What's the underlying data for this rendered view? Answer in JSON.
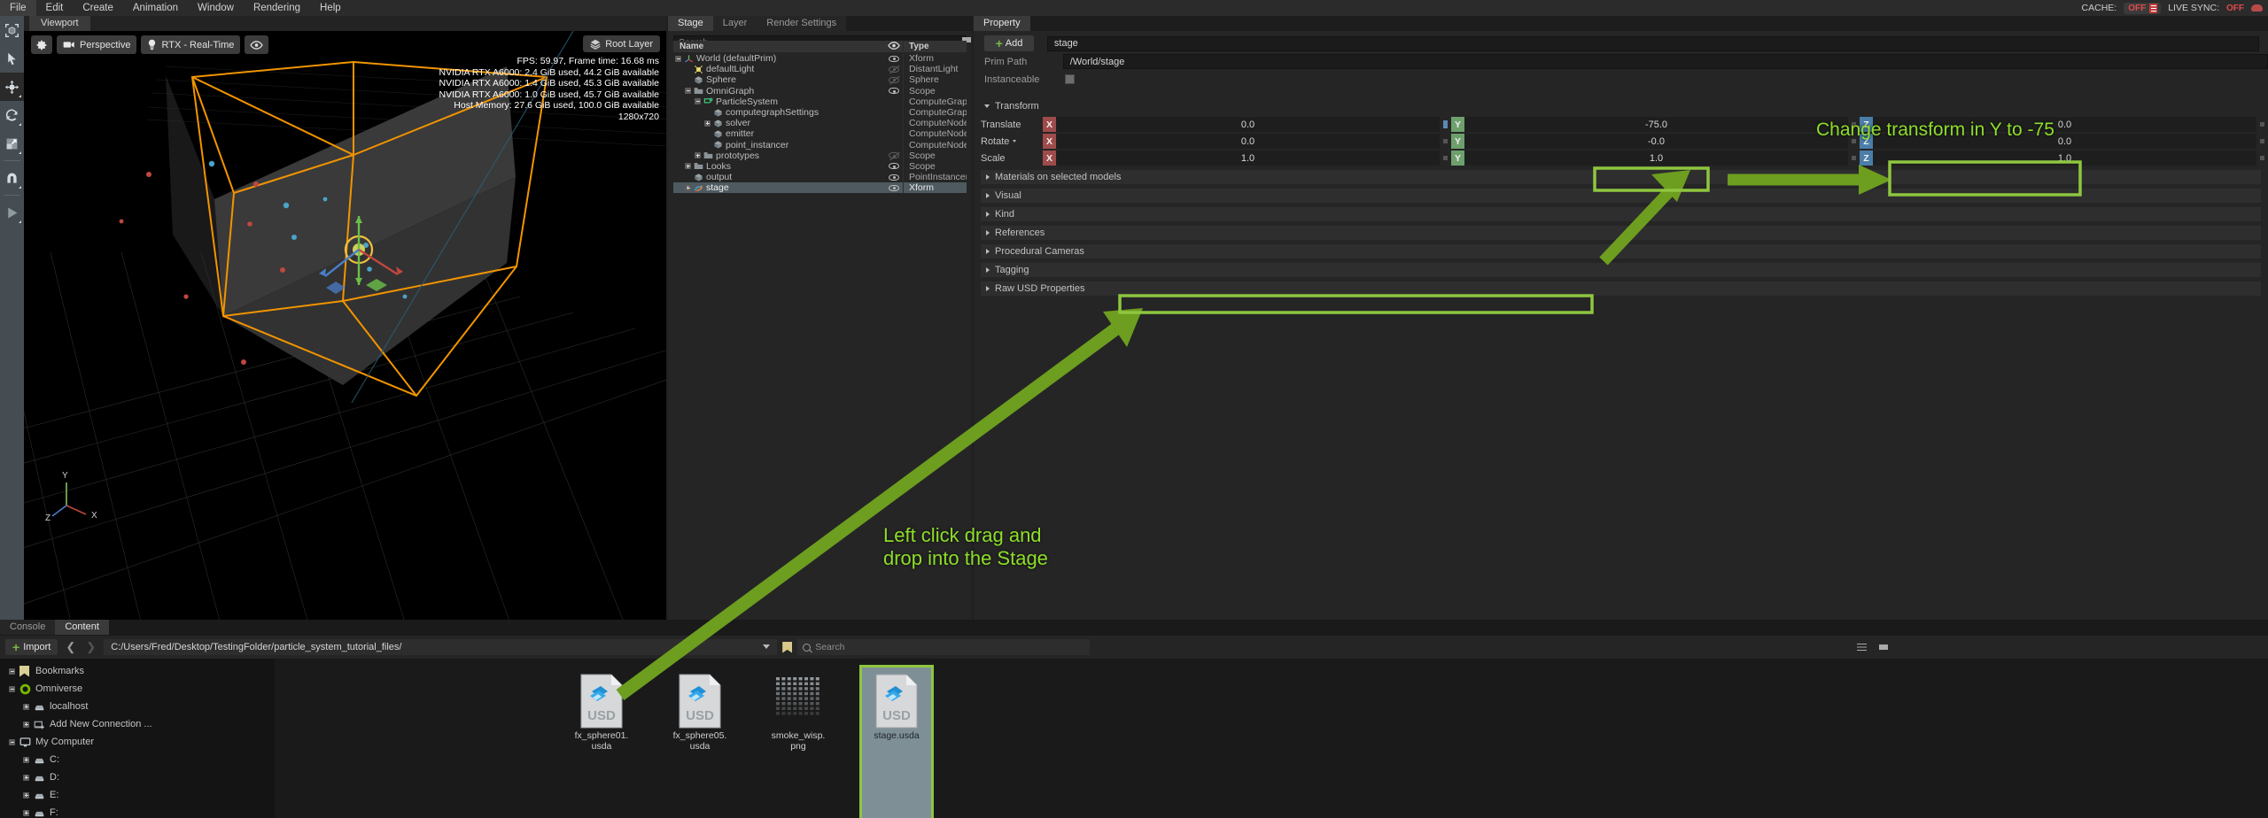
{
  "app": {
    "menu": [
      "File",
      "Edit",
      "Create",
      "Animation",
      "Window",
      "Rendering",
      "Help"
    ],
    "cache": {
      "label": "CACHE:",
      "value": "OFF",
      "icon": "document-icon"
    },
    "live_sync": {
      "label": "LIVE SYNC:",
      "value": "OFF",
      "icon": "cloud-icon"
    }
  },
  "left_toolbar": {
    "items": [
      {
        "name": "select-object-tool",
        "icon": "cube-in-brackets-icon",
        "selected": false
      },
      {
        "name": "pointer-tool",
        "icon": "cursor-arrow-icon",
        "selected": false
      },
      {
        "name": "move-tool",
        "icon": "move-arrows-icon",
        "selected": true
      },
      {
        "name": "rotate-tool",
        "icon": "rotate-circle-icon",
        "selected": false
      },
      {
        "name": "scale-tool",
        "icon": "scale-square-icon",
        "selected": false
      },
      {
        "name": "snap-tool",
        "icon": "magnet-icon",
        "selected": false
      },
      {
        "name": "play-tool",
        "icon": "play-triangle-icon",
        "selected": false
      }
    ]
  },
  "viewport": {
    "tab": "Viewport",
    "toolbar": {
      "settings_icon": "gear-icon",
      "camera_label": "Perspective",
      "camera_icon": "movie-camera-icon",
      "renderer_label": "RTX - Real-Time",
      "renderer_icon": "lightbulb-icon",
      "visibility_icon": "eye-icon"
    },
    "root_layer": {
      "label": "Root Layer",
      "icon": "layers-icon"
    },
    "stats": [
      "FPS: 59.97, Frame time: 16.68 ms",
      "NVIDIA RTX A6000: 2.4 GiB used,  44.2 GiB available",
      "NVIDIA RTX A6000: 1.4 GiB used,  45.3 GiB available",
      "NVIDIA RTX A6000: 1.0 GiB used,  45.7 GiB available",
      "Host Memory: 27.6 GiB used, 100.0 GiB available",
      "1280x720"
    ],
    "axis_gizmo": {
      "y": "Y",
      "x": "X",
      "z": "Z"
    }
  },
  "stage": {
    "tabs": [
      {
        "label": "Stage",
        "active": true
      },
      {
        "label": "Layer",
        "active": false
      },
      {
        "label": "Render Settings",
        "active": false
      }
    ],
    "search_placeholder": "Search",
    "filter_icon": "funnel-icon",
    "options_icon": "hamburger-icon",
    "columns": {
      "name": "Name",
      "visibility": "eye-icon",
      "type": "Type"
    },
    "rows": [
      {
        "name": "World (defaultPrim)",
        "type": "Xform",
        "indent": 0,
        "expander": "minus",
        "icon": "axis-tripod-icon",
        "eye": "visible",
        "selected": false
      },
      {
        "name": "defaultLight",
        "type": "DistantLight",
        "indent": 1,
        "expander": "none",
        "icon": "light-icon",
        "eye": "hidden",
        "selected": false
      },
      {
        "name": "Sphere",
        "type": "Sphere",
        "indent": 1,
        "expander": "none",
        "icon": "cube-icon",
        "eye": "hidden",
        "selected": false
      },
      {
        "name": "OmniGraph",
        "type": "Scope",
        "indent": 1,
        "expander": "minus",
        "icon": "folder-icon",
        "eye": "visible",
        "selected": false
      },
      {
        "name": "ParticleSystem",
        "type": "ComputeGraph",
        "indent": 2,
        "expander": "minus",
        "icon": "graph-icon",
        "eye": "none",
        "selected": false
      },
      {
        "name": "computegraphSettings",
        "type": "ComputeGraphSe",
        "indent": 3,
        "expander": "none",
        "icon": "cube-icon",
        "eye": "none",
        "selected": false
      },
      {
        "name": "solver",
        "type": "ComputeNode",
        "indent": 3,
        "expander": "plus",
        "icon": "cube-icon",
        "eye": "none",
        "selected": false
      },
      {
        "name": "emitter",
        "type": "ComputeNode",
        "indent": 3,
        "expander": "none",
        "icon": "cube-icon",
        "eye": "none",
        "selected": false
      },
      {
        "name": "point_instancer",
        "type": "ComputeNode",
        "indent": 3,
        "expander": "none",
        "icon": "cube-icon",
        "eye": "none",
        "selected": false
      },
      {
        "name": "prototypes",
        "type": "Scope",
        "indent": 2,
        "expander": "plus",
        "icon": "folder-icon",
        "eye": "hidden",
        "selected": false
      },
      {
        "name": "Looks",
        "type": "Scope",
        "indent": 1,
        "expander": "plus",
        "icon": "folder-icon",
        "eye": "visible",
        "selected": false
      },
      {
        "name": "output",
        "type": "PointInstancer",
        "indent": 1,
        "expander": "none",
        "icon": "cube-icon",
        "eye": "visible",
        "selected": false
      },
      {
        "name": "stage",
        "type": "Xform",
        "indent": 1,
        "expander": "plus",
        "icon": "stage-icon",
        "eye": "visible",
        "selected": true
      }
    ]
  },
  "property": {
    "tab": "Property",
    "add_button": "Add",
    "prim_name_value": "stage",
    "prim_path_label": "Prim Path",
    "prim_path_value": "/World/stage",
    "instanceable_label": "Instanceable",
    "instanceable_checked": false,
    "transform": {
      "label": "Transform",
      "expanded": true,
      "rows": [
        {
          "label": "Translate",
          "has_menu": false,
          "x": "0.0",
          "y": "-75.0",
          "z": "0.0"
        },
        {
          "label": "Rotate",
          "has_menu": true,
          "x": "0.0",
          "y": "-0.0",
          "z": "0.0"
        },
        {
          "label": "Scale",
          "has_menu": false,
          "x": "1.0",
          "y": "1.0",
          "z": "1.0"
        }
      ],
      "axis_labels": {
        "x": "X",
        "y": "Y",
        "z": "Z"
      }
    },
    "sections": [
      "Materials on selected models",
      "Visual",
      "Kind",
      "References",
      "Procedural Cameras",
      "Tagging",
      "Raw USD Properties"
    ]
  },
  "content": {
    "tabs": [
      {
        "label": "Console",
        "active": false
      },
      {
        "label": "Content",
        "active": true
      }
    ],
    "import_button": "Import",
    "back_icon": "chevron-left-icon",
    "forward_icon": "chevron-right-icon",
    "path": "C:/Users/Fred/Desktop/TestingFolder/particle_system_tutorial_files/",
    "path_caret_icon": "chevron-down-icon",
    "bookmark_icon": "bookmark-icon",
    "search_placeholder": "Search",
    "search_icon": "search-icon",
    "list_view_icon": "list-icon",
    "filter_icon": "funnel-icon",
    "tree": [
      {
        "label": "Bookmarks",
        "icon": "bookmark-icon",
        "expander": "minus",
        "indent": 0
      },
      {
        "label": "Omniverse",
        "icon": "omniverse-ring-icon",
        "expander": "minus",
        "indent": 0
      },
      {
        "label": "localhost",
        "icon": "server-icon",
        "expander": "plus",
        "indent": 1
      },
      {
        "label": "Add New Connection ...",
        "icon": "add-server-icon",
        "expander": "plus",
        "indent": 1
      },
      {
        "label": "My Computer",
        "icon": "monitor-icon",
        "expander": "minus",
        "indent": 0
      },
      {
        "label": "C:",
        "icon": "drive-icon",
        "expander": "plus",
        "indent": 1
      },
      {
        "label": "D:",
        "icon": "drive-icon",
        "expander": "plus",
        "indent": 1
      },
      {
        "label": "E:",
        "icon": "drive-icon",
        "expander": "plus",
        "indent": 1
      },
      {
        "label": "F:",
        "icon": "drive-icon",
        "expander": "plus",
        "indent": 1
      }
    ],
    "files": [
      {
        "name": "fx_sphere01.\nusda",
        "thumb": "usd-file-icon",
        "selected": false
      },
      {
        "name": "fx_sphere05.\nusda",
        "thumb": "usd-file-icon",
        "selected": false
      },
      {
        "name": "smoke_wisp.\npng",
        "thumb": "checker-image-icon",
        "selected": false
      },
      {
        "name": "stage.usda",
        "thumb": "usd-file-icon",
        "selected": true
      }
    ]
  },
  "annotations": {
    "drag_text": "Left click drag and\ndrop into the Stage",
    "transform_text": "Change transform in Y to -75",
    "color": "#8ede2a",
    "arrow_color": "#6d9e1f"
  }
}
